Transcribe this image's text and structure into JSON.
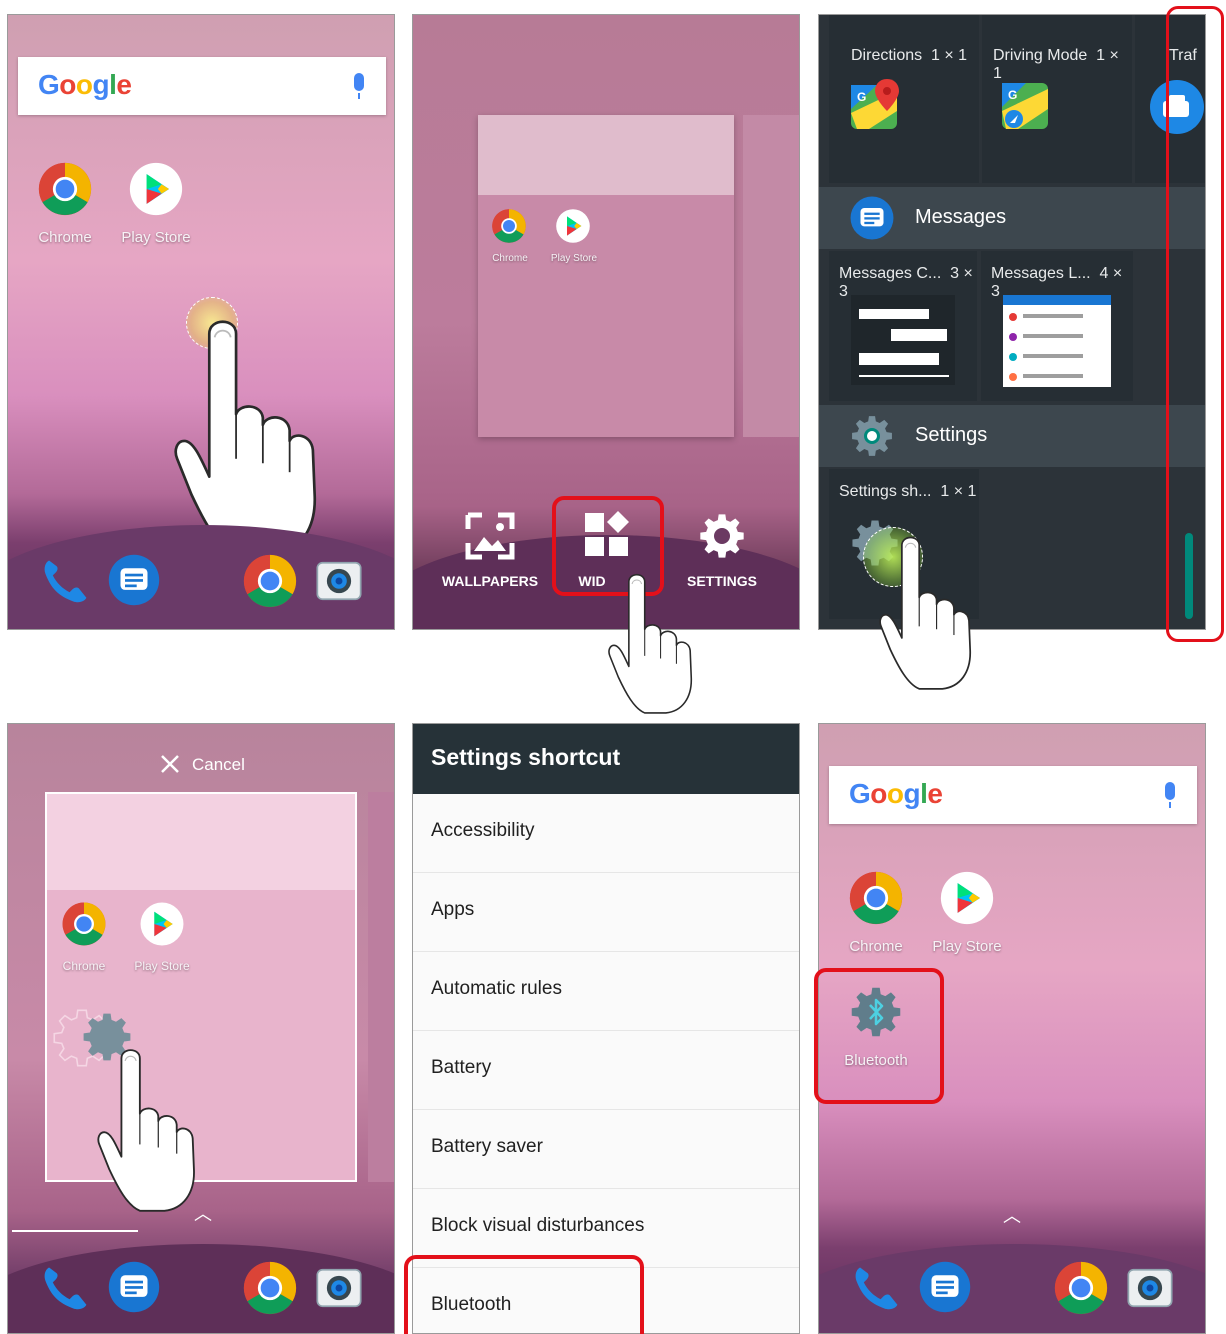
{
  "home": {
    "search_brand": "Google",
    "apps": [
      {
        "label": "Chrome",
        "icon": "chrome-icon"
      },
      {
        "label": "Play Store",
        "icon": "play-store-icon"
      }
    ],
    "dock": [
      "phone-icon",
      "messages-icon",
      "chrome-icon",
      "camera-icon"
    ]
  },
  "overview": {
    "preview_apps": [
      {
        "label": "Chrome"
      },
      {
        "label": "Play Store"
      }
    ],
    "options": [
      {
        "label": "WALLPAPERS",
        "icon": "wallpaper-icon"
      },
      {
        "label": "WIDGETS",
        "visible_text": "WID",
        "icon": "widgets-icon"
      },
      {
        "label": "SETTINGS",
        "icon": "settings-gear-icon"
      }
    ]
  },
  "widgets": {
    "maps_row": [
      {
        "title": "Directions",
        "size": "1 × 1"
      },
      {
        "title": "Driving Mode",
        "size": "1 × 1"
      },
      {
        "title": "Traf"
      }
    ],
    "messages_app": "Messages",
    "messages_row": [
      {
        "title": "Messages C...",
        "size": "3 × 3"
      },
      {
        "title": "Messages L...",
        "size": "4 × 3"
      }
    ],
    "settings_app": "Settings",
    "settings_row": [
      {
        "title": "Settings sh...",
        "size": "1 × 1"
      }
    ]
  },
  "placing": {
    "cancel_label": "Cancel",
    "preview_apps": [
      {
        "label": "Chrome"
      },
      {
        "label": "Play Store"
      }
    ]
  },
  "settings_shortcut": {
    "title": "Settings shortcut",
    "items": [
      "Accessibility",
      "Apps",
      "Automatic rules",
      "Battery",
      "Battery saver",
      "Block visual disturbances",
      "Bluetooth"
    ]
  },
  "result": {
    "search_brand": "Google",
    "apps": [
      {
        "label": "Chrome"
      },
      {
        "label": "Play Store"
      },
      {
        "label": "Bluetooth"
      }
    ]
  },
  "colors": {
    "highlight": "#e3101a",
    "dark_widget_bg": "#2c3339",
    "settings_header": "#263238"
  }
}
